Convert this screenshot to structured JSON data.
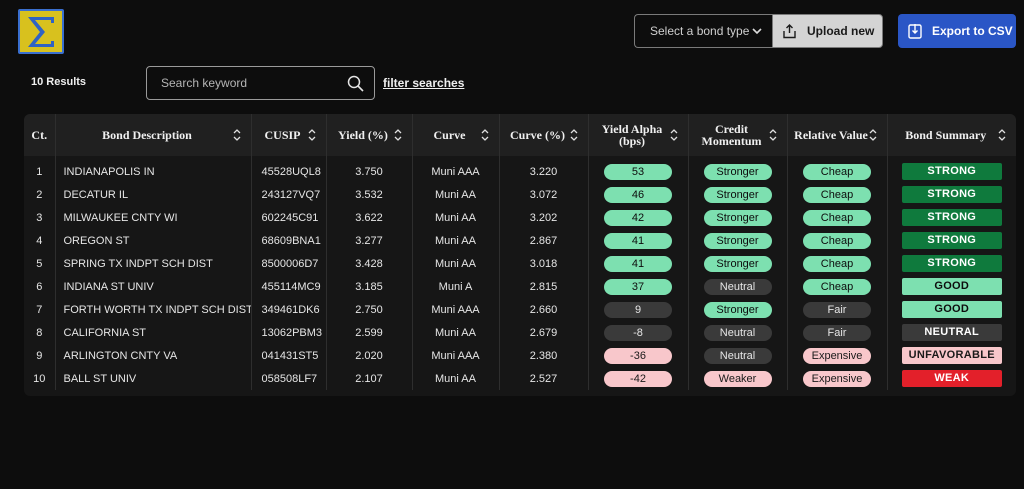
{
  "header": {
    "logo_icon": "sigma-icon",
    "bond_type_placeholder": "Select a bond type",
    "upload_label": "Upload new",
    "export_label": "Export to CSV"
  },
  "toolbar": {
    "results_label": "10 Results",
    "search_placeholder": "Search keyword",
    "filter_link": "filter searches"
  },
  "colors": {
    "green_pill": "#7de0b0",
    "dark_pill": "#3a3a3a",
    "pink_pill": "#f8c7cb",
    "strong_bg": "#0f7a3d",
    "good_bg": "#7de0b0",
    "neutral_bg": "#3a3a3a",
    "unfavorable_bg": "#f8c7cb",
    "weak_bg": "#e3202a",
    "accent": "#2a56c6"
  },
  "table": {
    "columns": [
      {
        "label": "Ct.",
        "sortable": false
      },
      {
        "label": "Bond Description",
        "sortable": true
      },
      {
        "label": "CUSIP",
        "sortable": true
      },
      {
        "label": "Yield (%)",
        "sortable": true
      },
      {
        "label": "Curve",
        "sortable": true
      },
      {
        "label": "Curve (%)",
        "sortable": true
      },
      {
        "label": "Yield Alpha (bps)",
        "sortable": true
      },
      {
        "label": "Credit Momentum",
        "sortable": true
      },
      {
        "label": "Relative Value",
        "sortable": true
      },
      {
        "label": "Bond Summary",
        "sortable": true
      }
    ],
    "rows": [
      {
        "ct": "1",
        "desc": "INDIANAPOLIS IN",
        "cusip": "45528UQL8",
        "yield": "3.750",
        "curve": "Muni AAA",
        "curve_pct": "3.220",
        "alpha": "53",
        "momentum": "Stronger",
        "value": "Cheap",
        "summary": "STRONG"
      },
      {
        "ct": "2",
        "desc": "DECATUR IL",
        "cusip": "243127VQ7",
        "yield": "3.532",
        "curve": "Muni AA",
        "curve_pct": "3.072",
        "alpha": "46",
        "momentum": "Stronger",
        "value": "Cheap",
        "summary": "STRONG"
      },
      {
        "ct": "3",
        "desc": "MILWAUKEE CNTY WI",
        "cusip": "602245C91",
        "yield": "3.622",
        "curve": "Muni AA",
        "curve_pct": "3.202",
        "alpha": "42",
        "momentum": "Stronger",
        "value": "Cheap",
        "summary": "STRONG"
      },
      {
        "ct": "4",
        "desc": "OREGON ST",
        "cusip": "68609BNA1",
        "yield": "3.277",
        "curve": "Muni AA",
        "curve_pct": "2.867",
        "alpha": "41",
        "momentum": "Stronger",
        "value": "Cheap",
        "summary": "STRONG"
      },
      {
        "ct": "5",
        "desc": "SPRING TX INDPT SCH DIST",
        "cusip": "8500006D7",
        "yield": "3.428",
        "curve": "Muni AA",
        "curve_pct": "3.018",
        "alpha": "41",
        "momentum": "Stronger",
        "value": "Cheap",
        "summary": "STRONG"
      },
      {
        "ct": "6",
        "desc": "INDIANA ST UNIV",
        "cusip": "455114MC9",
        "yield": "3.185",
        "curve": "Muni A",
        "curve_pct": "2.815",
        "alpha": "37",
        "momentum": "Neutral",
        "value": "Cheap",
        "summary": "GOOD"
      },
      {
        "ct": "7",
        "desc": "FORTH WORTH TX INDPT SCH DIST",
        "cusip": "349461DK6",
        "yield": "2.750",
        "curve": "Muni AAA",
        "curve_pct": "2.660",
        "alpha": "9",
        "momentum": "Stronger",
        "value": "Fair",
        "summary": "GOOD"
      },
      {
        "ct": "8",
        "desc": "CALIFORNIA ST",
        "cusip": "13062PBM3",
        "yield": "2.599",
        "curve": "Muni AA",
        "curve_pct": "2.679",
        "alpha": "-8",
        "momentum": "Neutral",
        "value": "Fair",
        "summary": "NEUTRAL"
      },
      {
        "ct": "9",
        "desc": "ARLINGTON CNTY VA",
        "cusip": "041431ST5",
        "yield": "2.020",
        "curve": "Muni AAA",
        "curve_pct": "2.380",
        "alpha": "-36",
        "momentum": "Neutral",
        "value": "Expensive",
        "summary": "UNFAVORABLE"
      },
      {
        "ct": "10",
        "desc": "BALL ST UNIV",
        "cusip": "058508LF7",
        "yield": "2.107",
        "curve": "Muni AA",
        "curve_pct": "2.527",
        "alpha": "-42",
        "momentum": "Weaker",
        "value": "Expensive",
        "summary": "WEAK"
      }
    ]
  }
}
